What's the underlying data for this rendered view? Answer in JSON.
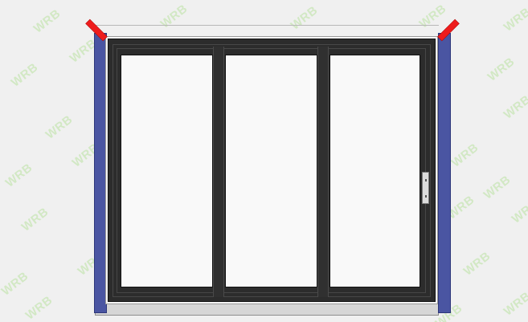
{
  "diagram": {
    "subject": "three-panel sliding door elevation",
    "colors": {
      "background": "#f0f0f0",
      "frame": "#2c2c2c",
      "glass": "#f9f9f9",
      "jamb": "#4a55a2",
      "marker": "#ee1c1c",
      "sill": "#d6d6d6",
      "watermark": "#cfe8c0"
    },
    "panel_count": 3,
    "handle_side": "right"
  },
  "watermark": {
    "text": "WRB"
  }
}
